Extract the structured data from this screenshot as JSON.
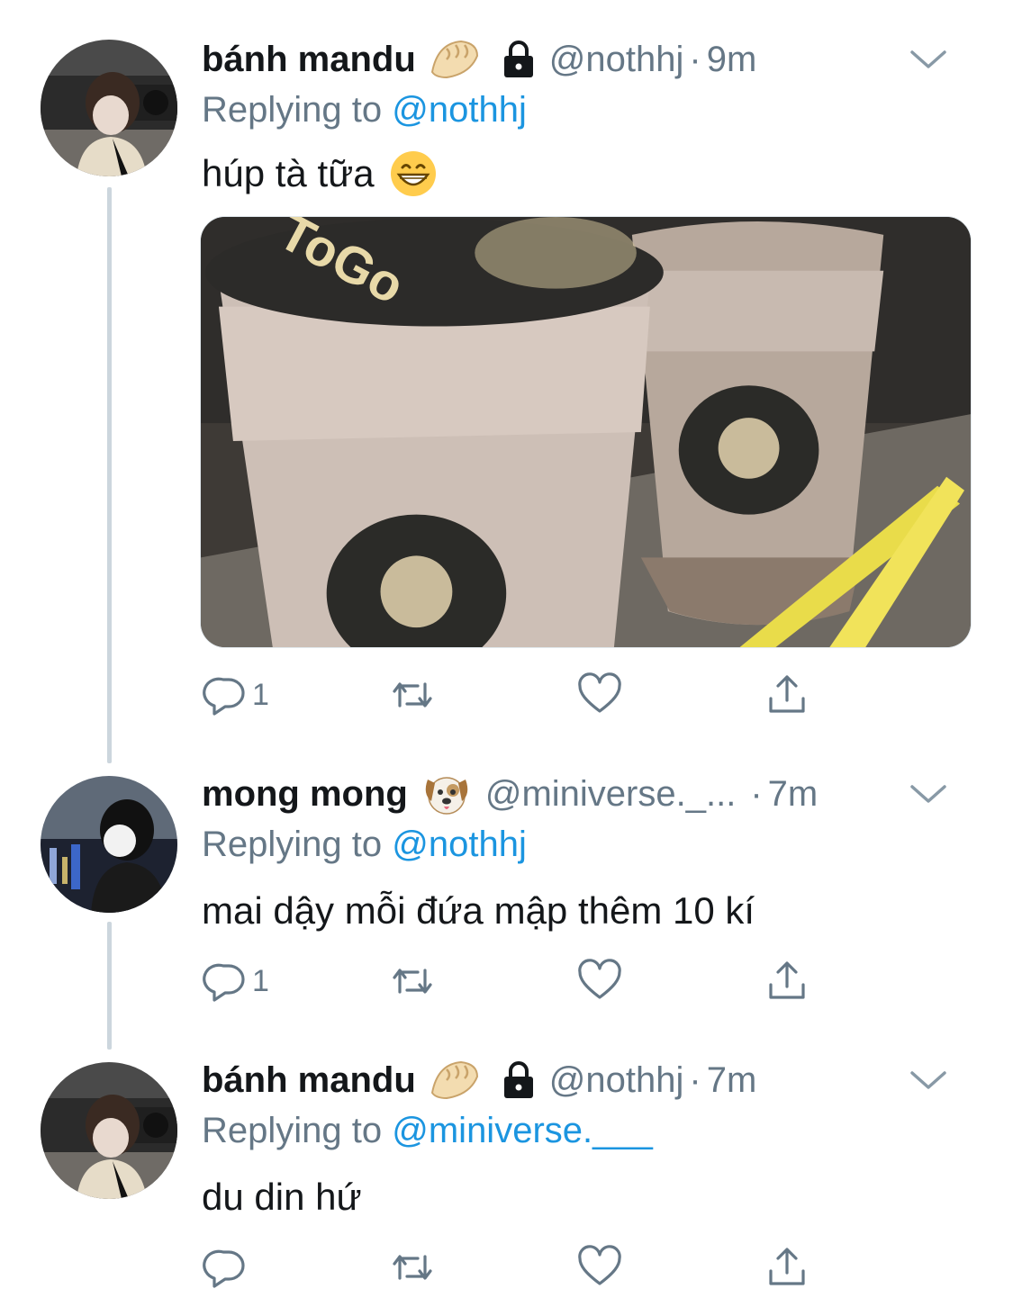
{
  "colors": {
    "text": "#14171a",
    "secondary": "#657786",
    "link": "#1b95e0",
    "thread_line": "#ccd6dd"
  },
  "tweets": [
    {
      "name": "bánh mandu",
      "name_emoji": "dumpling-emoji",
      "locked": true,
      "handle": "@nothhj",
      "separator": "·",
      "time": "9m",
      "replying_prefix": "Replying to",
      "replying_to": "@nothhj",
      "text": "húp tà tữa",
      "text_emoji": "grinning-face-emoji",
      "media": "bubble-tea-photo",
      "actions": {
        "reply_count": "1",
        "retweet_count": "",
        "like_count": ""
      }
    },
    {
      "name": "mong mong",
      "name_emoji": "dog-face-emoji",
      "locked": false,
      "handle": "@miniverse._...",
      "separator": "·",
      "time": "7m",
      "replying_prefix": "Replying to",
      "replying_to": "@nothhj",
      "text": "mai dậy mỗi đứa mập thêm 10 kí",
      "actions": {
        "reply_count": "1",
        "retweet_count": "",
        "like_count": ""
      }
    },
    {
      "name": "bánh mandu",
      "name_emoji": "dumpling-emoji",
      "locked": true,
      "handle": "@nothhj",
      "separator": "·",
      "time": "7m",
      "replying_prefix": "Replying to",
      "replying_to": "@miniverse.___",
      "text": "du din hứ",
      "actions": {
        "reply_count": "",
        "retweet_count": "",
        "like_count": ""
      }
    }
  ]
}
